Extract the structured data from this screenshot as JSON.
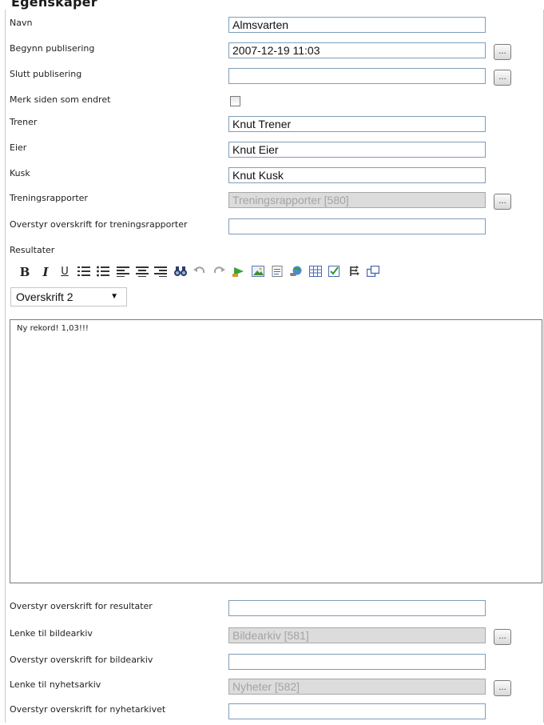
{
  "page": {
    "heading": "Egenskaper"
  },
  "fields": [
    {
      "label": "Navn",
      "value": "Almsvarten",
      "type": "text"
    },
    {
      "label": "Begynn publisering",
      "value": "2007-12-19 11:03",
      "type": "text-picker"
    },
    {
      "label": "Slutt publisering",
      "value": "",
      "type": "text-picker"
    },
    {
      "label": "Merk siden som endret",
      "checked": false,
      "type": "checkbox"
    },
    {
      "label": "Trener",
      "value": "Knut Trener",
      "type": "text"
    },
    {
      "label": "Eier",
      "value": "Knut Eier",
      "type": "text"
    },
    {
      "label": "Kusk",
      "value": "Knut Kusk",
      "type": "text"
    },
    {
      "label": "Treningsrapporter",
      "value": "Treningsrapporter [580]",
      "type": "disabled-picker"
    },
    {
      "label": "Overstyr overskrift for treningsrapporter",
      "value": "",
      "type": "text"
    }
  ],
  "results": {
    "label": "Resultater",
    "format_select": "Overskrift 2",
    "editor_text": "Ny rekord! 1,03!!!",
    "toolbar": [
      "bold-icon",
      "italic-icon",
      "underline-icon",
      "ordered-list-icon",
      "unordered-list-icon",
      "align-left-icon",
      "align-center-icon",
      "align-right-icon",
      "find-icon",
      "undo-icon",
      "redo-icon",
      "insert-link-icon",
      "insert-image-icon",
      "insert-document-icon",
      "insert-hyperlink-icon",
      "insert-table-icon",
      "spellcheck-icon",
      "paste-icon",
      "fullscreen-icon"
    ],
    "picker_label": "..."
  },
  "bottom_fields": [
    {
      "label": "Overstyr overskrift for resultater",
      "value": "",
      "type": "text"
    },
    {
      "label": "Lenke til bildearkiv",
      "value": "Bildearkiv [581]",
      "type": "disabled-picker"
    },
    {
      "label": "Overstyr overskrift for bildearkiv",
      "value": "",
      "type": "text"
    },
    {
      "label": "Lenke til nyhetsarkiv",
      "value": "Nyheter [582]",
      "type": "disabled-picker"
    },
    {
      "label": "Overstyr overskrift for nyhetarkivet",
      "value": "",
      "type": "text"
    }
  ]
}
